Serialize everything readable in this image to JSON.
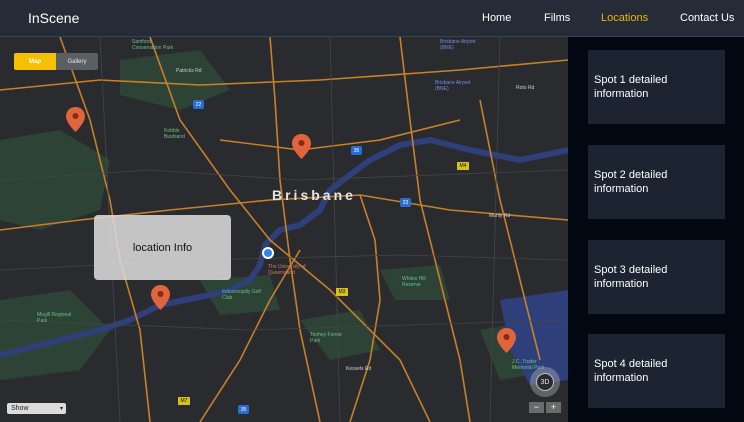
{
  "app": {
    "brand": "InScene"
  },
  "nav": {
    "links": [
      {
        "label": "Home",
        "active": false
      },
      {
        "label": "Films",
        "active": false
      },
      {
        "label": "Locations",
        "active": true
      },
      {
        "label": "Contact Us",
        "active": false
      }
    ]
  },
  "map": {
    "toggle": {
      "map_label": "Map",
      "gallery_label": "Gallery"
    },
    "info_box": "location Info",
    "select": {
      "value": "Show"
    },
    "compass_label": "3D",
    "zoom": {
      "out_label": "−",
      "in_label": "+"
    },
    "place_labels": {
      "city": "Brisbane",
      "samford": "Samford Conservation Park",
      "petricks": "Patricks Rd",
      "kobble": "Kobble Bushland",
      "forest_park": "Forest Park",
      "airport1": "Brisbane Airport (BNE)",
      "airport2": "Brisbane Airport (BNE)",
      "roto": "Roto Rd",
      "manly": "Manly Rd",
      "uq": "The University of Queensland",
      "indooroopilly": "Indooroopilly Golf Club",
      "whites_hill": "Whites Hill Reserve",
      "toohey": "Toohey Forest Park",
      "mtgravatt": "Mt Gravatt Rd",
      "kessels": "Kessels Rd",
      "mogill": "Mogill Regional Park",
      "jctrotter": "J.C. Trotter Memorial Park",
      "stuart": "Mt Cotton Rd",
      "ford": "Ford Rd",
      "hornrd": "Horn Rd"
    },
    "shields": {
      "s22": "22",
      "s35a": "35",
      "s35b": "35",
      "m4": "M4",
      "s23": "23",
      "m3": "M3",
      "m7": "M7",
      "s33": "33"
    },
    "colors": {
      "pin": "#e0643c",
      "road": "#c7802a",
      "water": "#2f3f7a",
      "park": "#2d4a37",
      "current": "#2e86e8"
    }
  },
  "spots": [
    {
      "label": "Spot 1 detailed information"
    },
    {
      "label": "Spot 2 detailed information"
    },
    {
      "label": "Spot 3 detailed information"
    },
    {
      "label": "Spot 4 detailed information"
    }
  ]
}
